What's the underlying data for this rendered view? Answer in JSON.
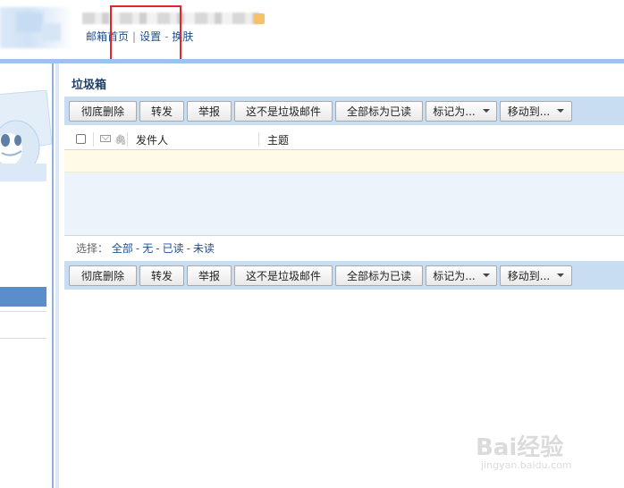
{
  "header": {
    "links": {
      "inbox_home": "邮箱首页",
      "settings": "设置",
      "skin": "换肤",
      "sep_bar": "|",
      "sep_dash": "-"
    },
    "badge_color": "#f5c26b",
    "highlight_color": "#e0262b"
  },
  "page": {
    "title": "垃圾箱"
  },
  "toolbar": {
    "delete_permanently": "彻底删除",
    "forward": "转发",
    "report": "举报",
    "not_spam": "这不是垃圾邮件",
    "mark_all_read": "全部标为已读",
    "mark_as": "标记为...",
    "move_to": "移动到..."
  },
  "list": {
    "columns": {
      "sender": "发件人",
      "subject": "主题"
    },
    "icons": [
      "envelope-icon",
      "paperclip-icon"
    ]
  },
  "select": {
    "label": "选择：",
    "all": "全部",
    "none": "无",
    "read": "已读",
    "unread": "未读",
    "sep": "-"
  },
  "watermark": {
    "brand": "Bai经验",
    "url": "jingyan.baidu.com"
  }
}
